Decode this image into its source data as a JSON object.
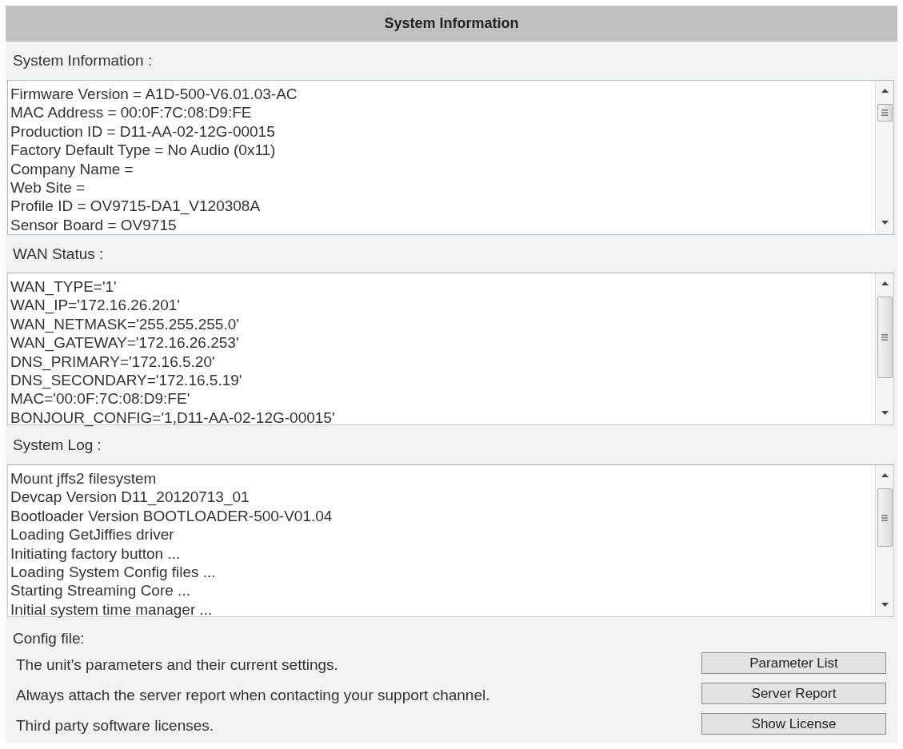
{
  "title": "System Information",
  "sections": [
    {
      "label": "System Information :",
      "focused": true,
      "lines": [
        "Firmware Version = A1D-500-V6.01.03-AC",
        "MAC Address = 00:0F:7C:08:D9:FE",
        "Production ID = D11-AA-02-12G-00015",
        "Factory Default Type = No Audio (0x11)",
        "Company Name =",
        "Web Site =",
        "Profile ID = OV9715-DA1_V120308A",
        "Sensor Board = OV9715"
      ]
    },
    {
      "label": "WAN Status :",
      "focused": false,
      "lines": [
        "WAN_TYPE='1'",
        "WAN_IP='172.16.26.201'",
        "WAN_NETMASK='255.255.255.0'",
        "WAN_GATEWAY='172.16.26.253'",
        "DNS_PRIMARY='172.16.5.20'",
        "DNS_SECONDARY='172.16.5.19'",
        "MAC='00:0F:7C:08:D9:FE'",
        "BONJOUR_CONFIG='1,D11-AA-02-12G-00015'"
      ]
    },
    {
      "label": "System Log :",
      "focused": false,
      "lines": [
        "Mount jffs2 filesystem",
        "Devcap Version D11_20120713_01",
        "Bootloader Version BOOTLOADER-500-V01.04",
        "Loading GetJiffies driver",
        "Initiating factory button ...",
        "Loading System Config files ...",
        "Starting Streaming Core ...",
        "Initial system time manager ..."
      ]
    }
  ],
  "config": {
    "label": "Config file:",
    "rows": [
      {
        "text": "The unit's parameters and their current settings.",
        "button": "Parameter List"
      },
      {
        "text": "Always attach the server report when contacting your support channel.",
        "button": "Server Report"
      },
      {
        "text": "Third party software licenses.",
        "button": "Show License"
      }
    ]
  }
}
